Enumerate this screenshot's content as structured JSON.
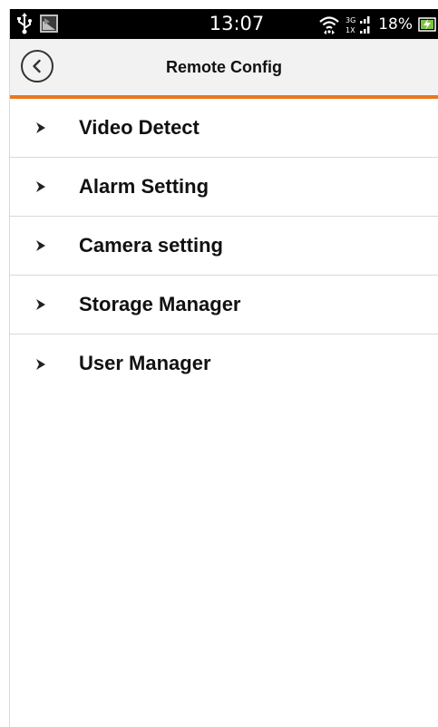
{
  "status_bar": {
    "time": "13:07",
    "battery_percent": "18%",
    "signal_label_top": "3G",
    "signal_label_bottom": "1X",
    "icons": [
      "usb-icon",
      "photo-icon",
      "wifi-icon",
      "signal-icon",
      "battery-charging-icon"
    ]
  },
  "header": {
    "title": "Remote Config",
    "back_icon": "chevron-left-icon"
  },
  "menu": {
    "items": [
      {
        "label": "Video Detect"
      },
      {
        "label": "Alarm Setting"
      },
      {
        "label": "Camera setting"
      },
      {
        "label": "Storage Manager"
      },
      {
        "label": "User Manager"
      }
    ]
  },
  "colors": {
    "accent": "#e8781e",
    "header_bg": "#f2f2f2",
    "status_bar_bg": "#000000",
    "divider": "#d9d9d9",
    "text": "#111111"
  }
}
